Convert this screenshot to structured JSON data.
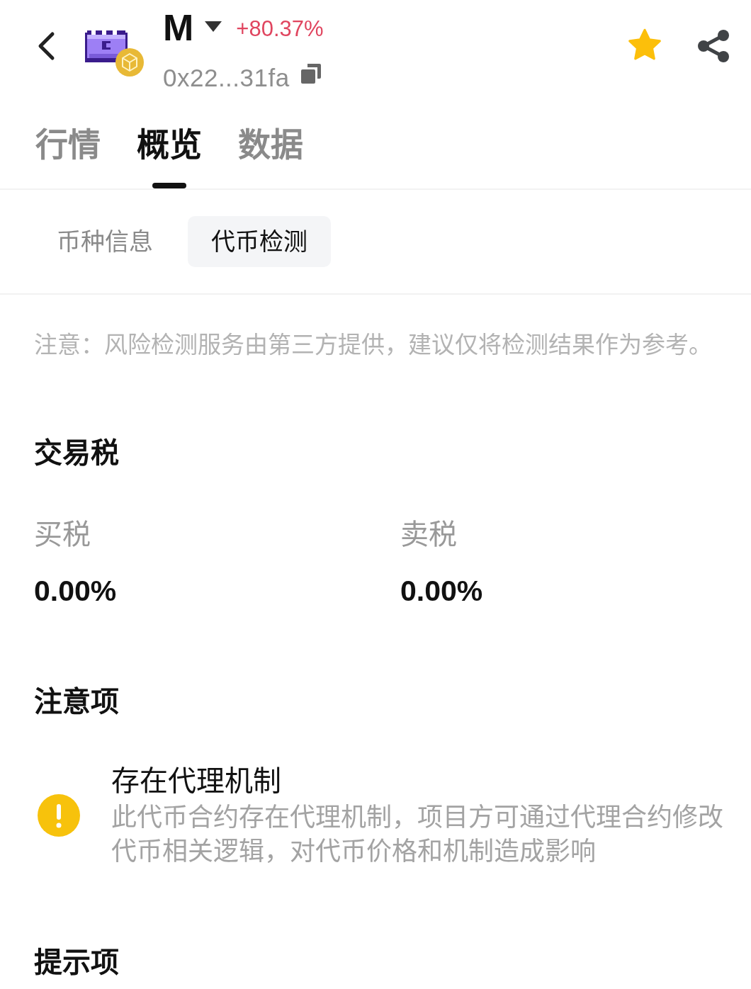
{
  "header": {
    "symbol": "M",
    "change": "+80.37%",
    "address": "0x22...31fa",
    "favorited": true
  },
  "tabs": [
    {
      "label": "行情",
      "selected": false
    },
    {
      "label": "概览",
      "selected": true
    },
    {
      "label": "数据",
      "selected": false
    }
  ],
  "sub_tabs": [
    {
      "label": "币种信息",
      "selected": false
    },
    {
      "label": "代币检测",
      "selected": true
    }
  ],
  "notice": "注意：风险检测服务由第三方提供，建议仅将检测结果作为参考。",
  "sections": [
    {
      "title": "交易税",
      "kind": "taxes",
      "items": [
        {
          "label": "买税",
          "value": "0.00%"
        },
        {
          "label": "卖税",
          "value": "0.00%"
        }
      ]
    },
    {
      "title": "注意项",
      "kind": "alerts",
      "items": [
        {
          "kind": "warning",
          "title": "存在代理机制",
          "description": "此代币合约存在代理机制，项目方可通过代理合约修改代币相关逻辑，对代币价格和机制造成影响"
        }
      ]
    },
    {
      "title": "提示项"
    }
  ]
}
